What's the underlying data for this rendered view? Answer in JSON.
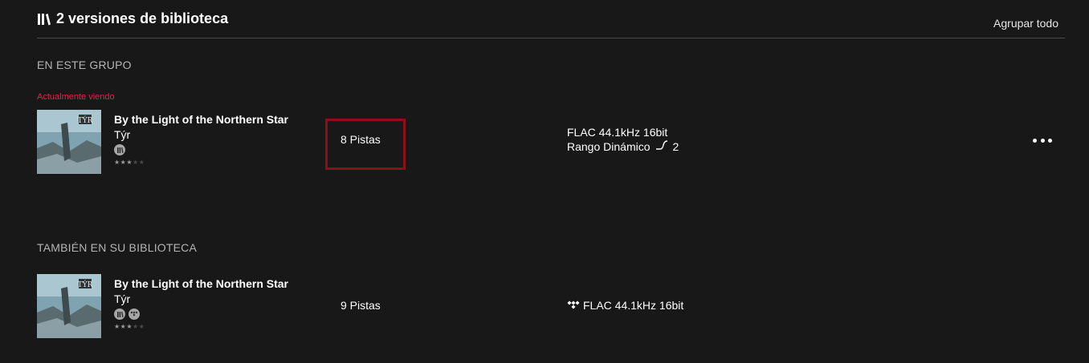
{
  "header": {
    "icon": "library-icon",
    "title": "2 versiones de biblioteca",
    "group_all": "Agrupar todo"
  },
  "sections": {
    "in_group": {
      "title": "EN ESTE GRUPO",
      "current_label": "Actualmente viendo",
      "item": {
        "album": "By the Light of the Northern Star",
        "artist": "Týr",
        "badges": [
          "library-badge-icon"
        ],
        "rating": 3,
        "rating_max": 5,
        "tracks": "8 Pistas",
        "format": "FLAC 44.1kHz 16bit",
        "dr_label": "Rango Dinámico",
        "dr_value": "2"
      }
    },
    "also_in_library": {
      "title": "TAMBIÉN EN SU BIBLIOTECA",
      "item": {
        "album": "By the Light of the Northern Star",
        "artist": "Týr",
        "badges": [
          "library-badge-icon",
          "tidal-badge-icon"
        ],
        "rating": 3,
        "rating_max": 5,
        "tracks": "9 Pistas",
        "source_icon": "tidal-icon",
        "format": "FLAC 44.1kHz 16bit"
      }
    }
  },
  "colors": {
    "background": "#181818",
    "accent_current": "#e0244a",
    "highlight_border": "#8c0f1a"
  }
}
